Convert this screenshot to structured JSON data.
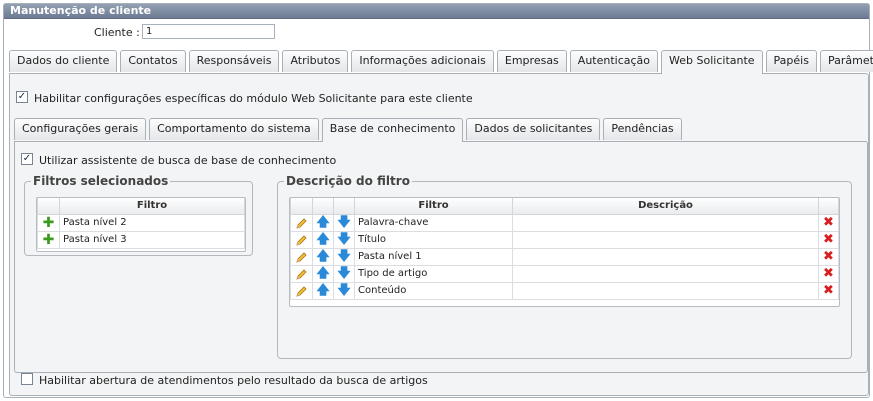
{
  "panel": {
    "title": "Manutenção de cliente"
  },
  "client": {
    "label": "Cliente :",
    "value": "1"
  },
  "main_tabs": [
    {
      "label": "Dados do cliente"
    },
    {
      "label": "Contatos"
    },
    {
      "label": "Responsáveis"
    },
    {
      "label": "Atributos"
    },
    {
      "label": "Informações adicionais"
    },
    {
      "label": "Empresas"
    },
    {
      "label": "Autenticação"
    },
    {
      "label": "Web Solicitante",
      "active": true
    },
    {
      "label": "Papéis"
    },
    {
      "label": "Parâmetros"
    }
  ],
  "enable_specific": {
    "checked": true,
    "label": "Habilitar configurações específicas do módulo Web Solicitante para este cliente"
  },
  "sub_tabs": [
    {
      "label": "Configurações gerais"
    },
    {
      "label": "Comportamento do sistema"
    },
    {
      "label": "Base de conhecimento",
      "active": true
    },
    {
      "label": "Dados de solicitantes"
    },
    {
      "label": "Pendências"
    }
  ],
  "use_assistant": {
    "checked": true,
    "label": "Utilizar assistente de busca de base de conhecimento"
  },
  "selected_filters": {
    "legend": "Filtros selecionados",
    "header": "Filtro",
    "rows": [
      "Pasta nível 2",
      "Pasta nível 3"
    ]
  },
  "filter_description": {
    "legend": "Descrição do filtro",
    "header_filter": "Filtro",
    "header_description": "Descrição",
    "rows": [
      {
        "filter": "Palavra-chave",
        "description": ""
      },
      {
        "filter": "Título",
        "description": ""
      },
      {
        "filter": "Pasta nível 1",
        "description": ""
      },
      {
        "filter": "Tipo de artigo",
        "description": ""
      },
      {
        "filter": "Conteúdo",
        "description": ""
      }
    ]
  },
  "enable_opening": {
    "checked": false,
    "label": "Habilitar abertura de atendimentos pelo resultado da busca de artigos"
  },
  "icons": {
    "add": "plus-icon",
    "edit": "pencil-icon",
    "up": "arrow-up-icon",
    "down": "arrow-down-icon",
    "delete": "delete-x-icon"
  }
}
